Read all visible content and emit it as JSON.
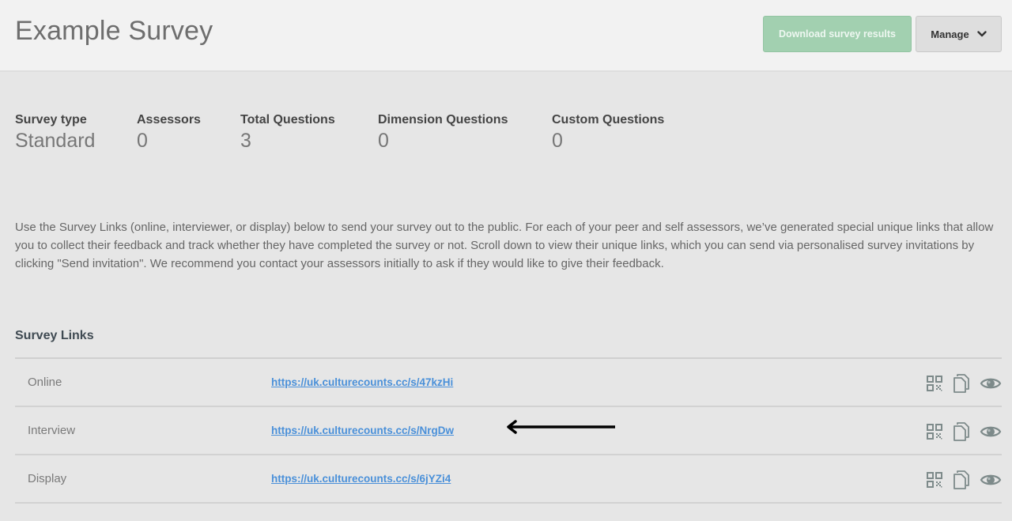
{
  "header": {
    "title": "Example Survey",
    "download_button": "Download survey results",
    "manage_button": "Manage",
    "colors": {
      "download_bg": "#a2d0b0",
      "link": "#4a90d9"
    }
  },
  "stats": [
    {
      "label": "Survey type",
      "value": "Standard"
    },
    {
      "label": "Assessors",
      "value": "0"
    },
    {
      "label": "Total Questions",
      "value": "3"
    },
    {
      "label": "Dimension Questions",
      "value": "0"
    },
    {
      "label": "Custom Questions",
      "value": "0"
    }
  ],
  "intro": "Use the Survey Links (online, interviewer, or display) below to send your survey out to the public. For each of your peer and self assessors, we’ve generated special unique links that allow you to collect their feedback and track whether they have completed the survey or not. Scroll down to view their unique links, which you can send via personalised survey invitations by clicking \"Send invitation\". We recommend you contact your assessors initially to ask if they would like to give their feedback.",
  "survey_links": {
    "heading": "Survey Links",
    "rows": [
      {
        "label": "Online",
        "url": "https://uk.culturecounts.cc/s/47kzHi",
        "icons": [
          "qr-code-icon",
          "copy-icon",
          "preview-eye-icon"
        ]
      },
      {
        "label": "Interview",
        "url": "https://uk.culturecounts.cc/s/NrgDw",
        "icons": [
          "qr-code-icon",
          "copy-icon",
          "preview-eye-icon"
        ]
      },
      {
        "label": "Display",
        "url": "https://uk.culturecounts.cc/s/6jYZi4",
        "icons": [
          "qr-code-icon",
          "copy-icon",
          "preview-eye-icon"
        ]
      }
    ]
  },
  "annotation": {
    "arrow_points_to": "Interview"
  }
}
